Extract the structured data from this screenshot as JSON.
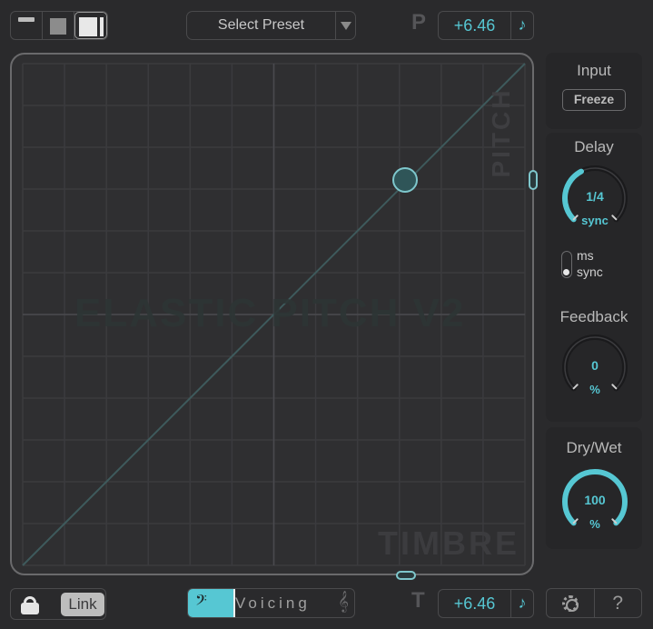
{
  "top_bar": {
    "view_modes": [
      {
        "name": "minimal",
        "icon": "view-line-icon",
        "active": false
      },
      {
        "name": "compact",
        "icon": "view-square-icon",
        "active": false
      },
      {
        "name": "full",
        "icon": "view-wide-icon",
        "active": true
      }
    ],
    "preset": {
      "label": "Select Preset",
      "arrow": "▼"
    },
    "pitch_letter": "P",
    "pitch_value": "+6.46",
    "pitch_note_icon": "♪"
  },
  "pad": {
    "x_axis_label": "TIMBRE",
    "y_axis_label": "PITCH",
    "watermark": "ELASTIC PITCH V2",
    "point": {
      "timbre": 0.77,
      "pitch": 0.77
    },
    "pitch_handle": 0.77,
    "timbre_handle": 0.77,
    "grid_divisions": 12,
    "accent_color": "#56c7d3"
  },
  "right_panel": {
    "input": {
      "title": "Input",
      "freeze_label": "Freeze"
    },
    "delay": {
      "title": "Delay",
      "value": "1/4",
      "unit": "sync",
      "fraction": 0.4,
      "mode_options": [
        "ms",
        "sync"
      ],
      "mode_selected": "sync"
    },
    "feedback": {
      "title": "Feedback",
      "value": "0",
      "unit": "%",
      "fraction": 0.0
    },
    "dry_wet": {
      "title": "Dry/Wet",
      "value": "100",
      "unit": "%",
      "fraction": 1.0
    }
  },
  "bottom_bar": {
    "link_label": "Link",
    "voicing_label": "Voicing",
    "voicing_fraction": 0.28,
    "bass_clef": "𝄢",
    "treble_clef": "𝄞",
    "timbre_letter": "T",
    "timbre_value": "+6.46",
    "timbre_note_icon": "♪",
    "help_label": "?"
  }
}
